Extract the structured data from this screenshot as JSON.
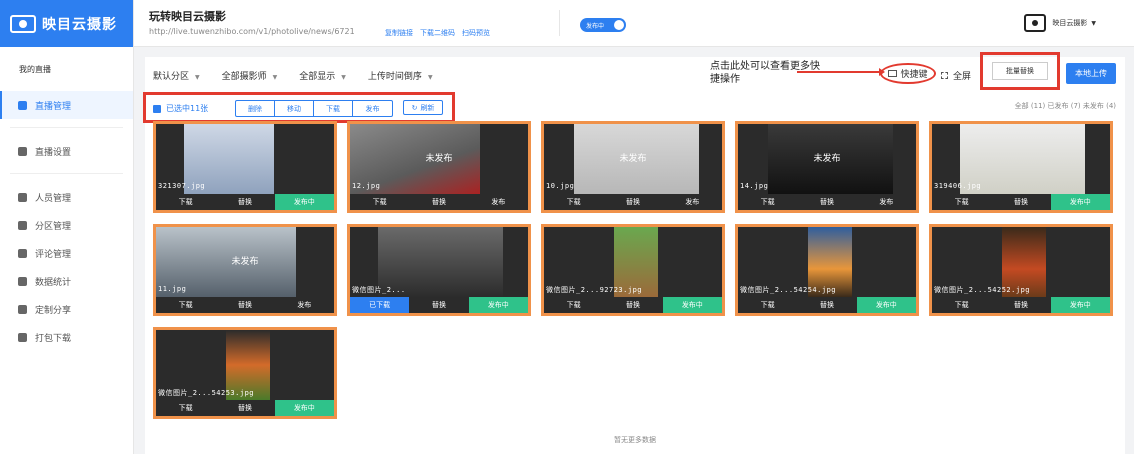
{
  "sidebar": {
    "logo_text": "映目云摄影",
    "section_title": "我的直播",
    "items": [
      {
        "label": "直播管理",
        "icon": "edit-icon"
      },
      {
        "label": "直播设置",
        "icon": "gear-icon"
      },
      {
        "label": "人员管理",
        "icon": "user-icon"
      },
      {
        "label": "分区管理",
        "icon": "grid-icon"
      },
      {
        "label": "评论管理",
        "icon": "comment-icon"
      },
      {
        "label": "数据统计",
        "icon": "pie-chart-icon"
      },
      {
        "label": "定制分享",
        "icon": "share-icon"
      },
      {
        "label": "打包下载",
        "icon": "download-icon"
      }
    ]
  },
  "header": {
    "title": "玩转映目云摄影",
    "url": "http://live.tuwenzhibo.com/v1/photolive/news/6721",
    "links": [
      "复制链接",
      "下载二维码",
      "扫码预览"
    ],
    "status_toggle": "发布中",
    "user_name": "映目云摄影"
  },
  "toolbar": {
    "filters": [
      "默认分区",
      "全部摄影师",
      "全部显示",
      "上传时间倒序"
    ],
    "annotation": "点击此处可以查看更多快捷操作",
    "shortcut_label": "快捷键",
    "fullscreen_label": "全屏",
    "batch_replace_label": "批量替换",
    "upload_label": "本地上传"
  },
  "selection": {
    "selected_label": "已选中11张",
    "actions": [
      "删除",
      "移动",
      "下载",
      "发布"
    ],
    "refresh_label": "刷新"
  },
  "counts": "全部 (11) 已发布 (7) 未发布 (4)",
  "photos": [
    {
      "filename": "321307.jpg",
      "overlay": "",
      "buttons": [
        "下载",
        "替换",
        "发布中"
      ],
      "state": "live"
    },
    {
      "filename": "12.jpg",
      "overlay": "未发布",
      "buttons": [
        "下载",
        "替换",
        "发布"
      ],
      "state": "off"
    },
    {
      "filename": "10.jpg",
      "overlay": "未发布",
      "buttons": [
        "下载",
        "替换",
        "发布"
      ],
      "state": "off"
    },
    {
      "filename": "14.jpg",
      "overlay": "未发布",
      "buttons": [
        "下载",
        "替换",
        "发布"
      ],
      "state": "off"
    },
    {
      "filename": "319406.jpg",
      "overlay": "",
      "buttons": [
        "下载",
        "替换",
        "发布中"
      ],
      "state": "live"
    },
    {
      "filename": "11.jpg",
      "overlay": "未发布",
      "buttons": [
        "下载",
        "替换",
        "发布"
      ],
      "state": "off"
    },
    {
      "filename": "微信图片_2...",
      "overlay": "",
      "buttons": [
        "已下载",
        "替换",
        "发布中"
      ],
      "state": "live-done"
    },
    {
      "filename": "微信图片_2...92723.jpg",
      "overlay": "",
      "buttons": [
        "下载",
        "替换",
        "发布中"
      ],
      "state": "live"
    },
    {
      "filename": "微信图片_2...54254.jpg",
      "overlay": "",
      "buttons": [
        "下载",
        "替换",
        "发布中"
      ],
      "state": "live"
    },
    {
      "filename": "微信图片_2...54252.jpg",
      "overlay": "",
      "buttons": [
        "下载",
        "替换",
        "发布中"
      ],
      "state": "live"
    },
    {
      "filename": "微信图片_2...54253.jpg",
      "overlay": "",
      "buttons": [
        "下载",
        "替换",
        "发布中"
      ],
      "state": "live"
    }
  ],
  "footer_text": "暂无更多数据",
  "colors": {
    "accent": "#2d7ff0",
    "live": "#2fc28a",
    "highlight": "#e23a2f",
    "card_border": "#f0924a"
  }
}
